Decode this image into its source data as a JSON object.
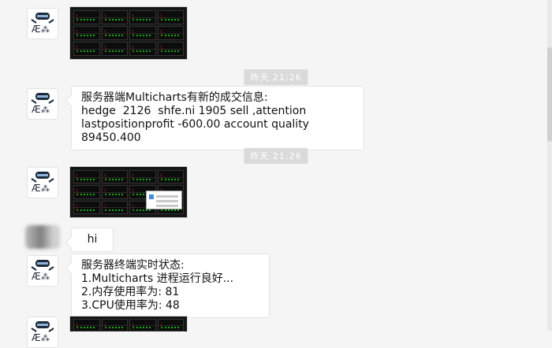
{
  "chat": {
    "time_separator_1": "昨天 21:26",
    "time_separator_2": "昨天 21:26",
    "messages": {
      "trade_info": "服务器端Multicharts有新的成交信息:\nhedge  2126  shfe.ni 1905 sell ,attention\nlastpositionprofit -600.00 account quality\n89450.400",
      "hi": "hi",
      "status": "服务器终端实时状态:\n1.Multicharts 进程运行良好...\n2.内存使用率为: 81\n3.CPU使用率为: 48"
    }
  },
  "icons": {
    "bot_avatar": "robot-avatar-icon",
    "user_avatar": "blurred-avatar",
    "image_thumbnail": "trading-screenshot-thumbnail"
  },
  "colors": {
    "background": "#f5f5f5",
    "bubble": "#ffffff",
    "time_pill": "#dadada"
  }
}
